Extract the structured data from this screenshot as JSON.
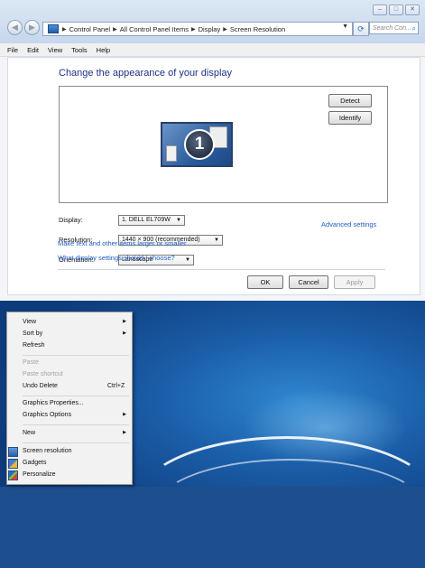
{
  "window": {
    "buttons": {
      "minimize": "–",
      "maximize": "□",
      "close": "✕"
    },
    "breadcrumbs": [
      "Control Panel",
      "All Control Panel Items",
      "Display",
      "Screen Resolution"
    ],
    "search_placeholder": "Search Con...",
    "menu": [
      "File",
      "Edit",
      "View",
      "Tools",
      "Help"
    ]
  },
  "display": {
    "heading": "Change the appearance of your display",
    "monitor_number": "1",
    "detect_label": "Detect",
    "identify_label": "Identify",
    "display_label": "Display:",
    "display_value": "1. DELL EL709W",
    "resolution_label": "Resolution:",
    "resolution_value": "1440 × 900 (recommended)",
    "orientation_label": "Orientation:",
    "orientation_value": "Landscape",
    "advanced_link": "Advanced settings",
    "link_text_size": "Make text and other items larger or smaller",
    "link_settings_help": "What display settings should I choose?",
    "ok_label": "OK",
    "cancel_label": "Cancel",
    "apply_label": "Apply"
  },
  "context_menu": {
    "view": "View",
    "sort_by": "Sort by",
    "refresh": "Refresh",
    "paste": "Paste",
    "paste_shortcut": "Paste shortcut",
    "undo_delete": "Undo Delete",
    "undo_shortcut": "Ctrl+Z",
    "graphics_properties": "Graphics Properties...",
    "graphics_options": "Graphics Options",
    "new": "New",
    "screen_resolution": "Screen resolution",
    "gadgets": "Gadgets",
    "personalize": "Personalize"
  },
  "colors": {
    "heading": "#1e3287",
    "link": "#1f5cc2",
    "desktop": "#1b5ea9"
  }
}
